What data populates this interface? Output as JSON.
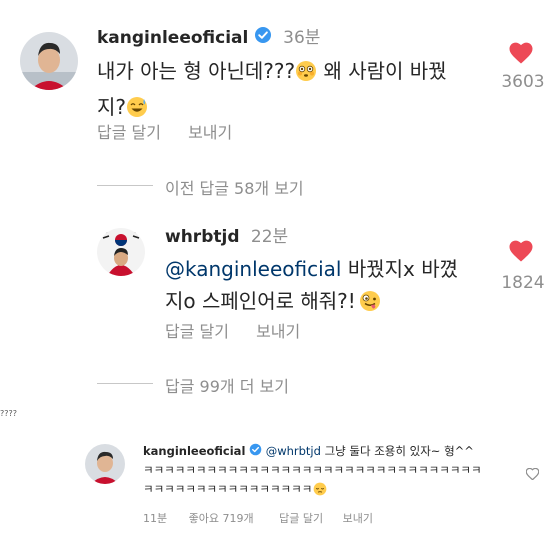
{
  "comment1": {
    "username": "kanginleeoficial",
    "time": "36분",
    "text_line1": "내가 아는 형 아닌데???",
    "text_line1b": " 왜 사람이 바꿨",
    "text_line2": "지?",
    "like_count": "3603",
    "reply_label": "답글 달기",
    "send_label": "보내기"
  },
  "view_prev": {
    "label": "이전 답글 58개 보기"
  },
  "reply1": {
    "username": "whrbtjd",
    "time": "22분",
    "mention": "@kanginleeoficial",
    "text_line1": " 바꿨지x 바꼈",
    "text_line2": "지o 스페인어로 해줘?!",
    "like_count": "1824",
    "reply_label": "답글 달기",
    "send_label": "보내기"
  },
  "view_more": {
    "label": "답글 99개 더 보기"
  },
  "side_text": "????",
  "reply2": {
    "username": "kanginleeoficial",
    "mention": "@whrbtjd",
    "text_line1": " 그냥 둘다 조용히 있자~ 형^^",
    "text_line2": "ㅋㅋㅋㅋㅋㅋㅋㅋㅋㅋㅋㅋㅋㅋㅋㅋㅋㅋㅋㅋㅋㅋㅋㅋㅋㅋㅋㅋㅋㅋㅋㅋ",
    "text_line3": "ㅋㅋㅋㅋㅋㅋㅋㅋㅋㅋㅋㅋㅋㅋㅋㅋ",
    "time": "11분",
    "likes": "좋아요 719개",
    "reply_label": "답글 달기",
    "send_label": "보내기"
  },
  "colors": {
    "heart": "#ed4956",
    "verified": "#3897f0",
    "mention": "#00376b",
    "muted": "#8e8e8e"
  }
}
